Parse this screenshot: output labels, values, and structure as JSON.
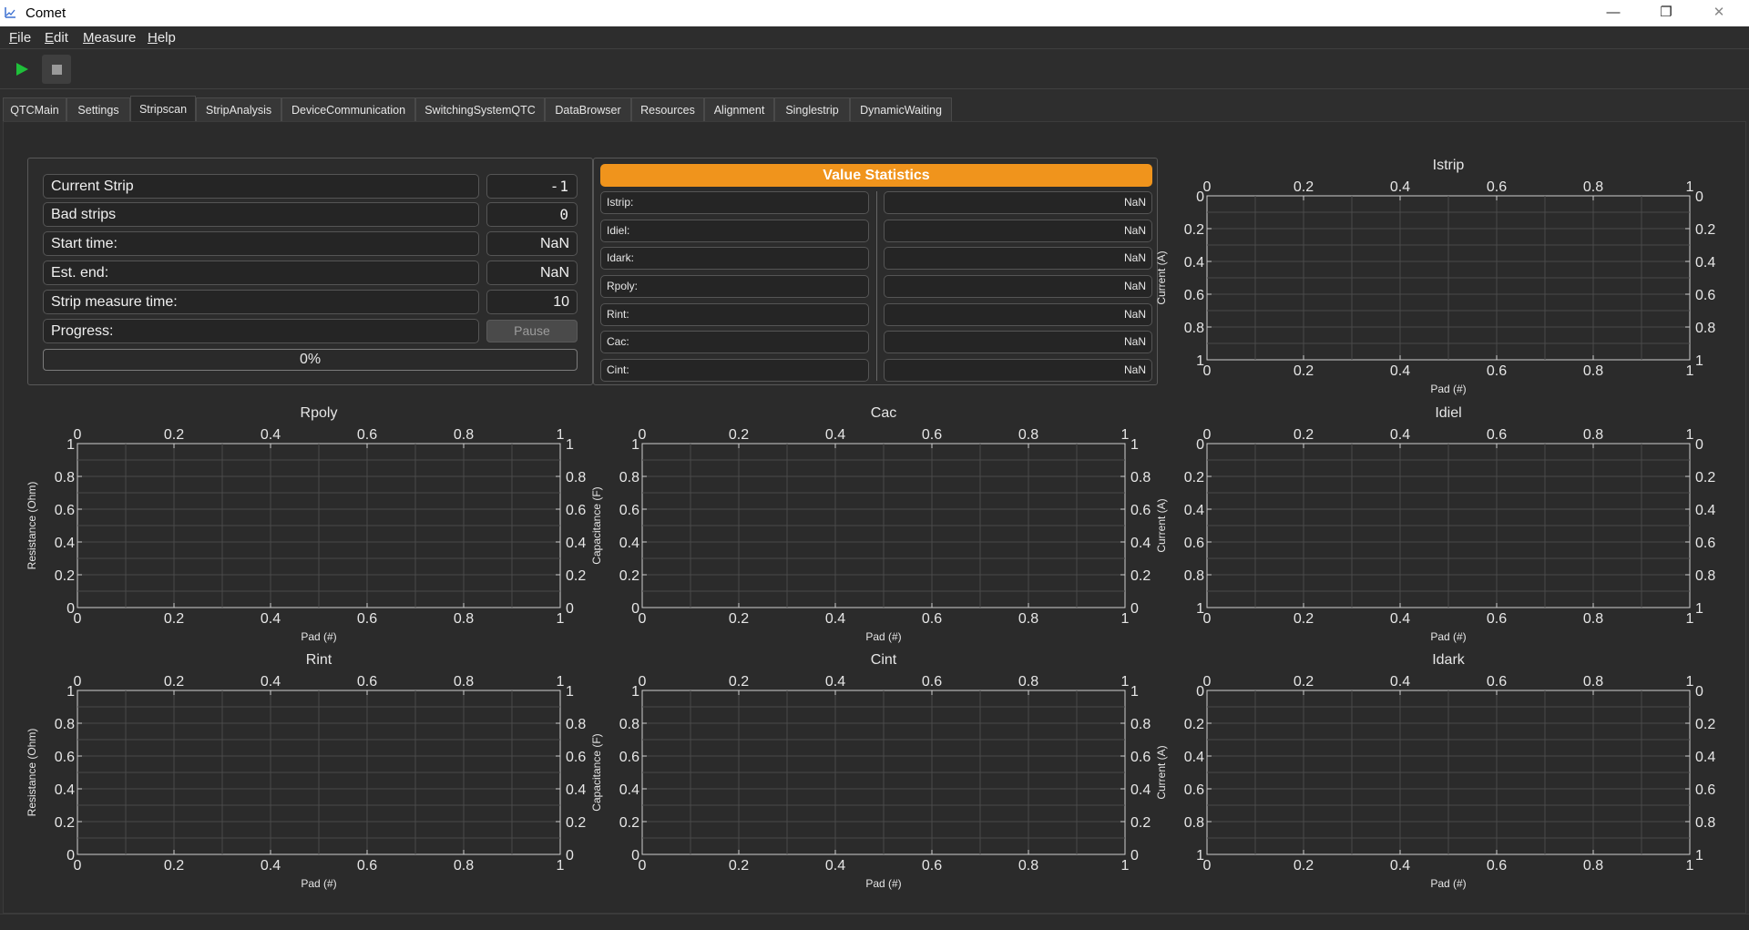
{
  "window": {
    "title": "Comet",
    "minimize": "—",
    "restore": "❐",
    "close": "✕"
  },
  "menu": [
    {
      "label": "File",
      "underline": "F",
      "rest": "ile"
    },
    {
      "label": "Edit",
      "underline": "E",
      "rest": "dit"
    },
    {
      "label": "Measure",
      "underline": "M",
      "rest": "easure"
    },
    {
      "label": "Help",
      "underline": "H",
      "rest": "elp"
    }
  ],
  "toolbar": {
    "start_icon": "play-icon",
    "stop_icon": "stop-icon",
    "start_color": "#1fbf3a",
    "stop_color": "#8a8a8a"
  },
  "tabs": [
    {
      "label": "QTCMain"
    },
    {
      "label": "Settings"
    },
    {
      "label": "Stripscan",
      "active": true
    },
    {
      "label": "StripAnalysis"
    },
    {
      "label": "DeviceCommunication"
    },
    {
      "label": "SwitchingSystemQTC"
    },
    {
      "label": "DataBrowser"
    },
    {
      "label": "Resources"
    },
    {
      "label": "Alignment"
    },
    {
      "label": "Singlestrip"
    },
    {
      "label": "DynamicWaiting"
    }
  ],
  "info": {
    "current_strip_label": "Current Strip",
    "current_strip_value": "-1",
    "bad_strips_label": "Bad strips",
    "bad_strips_value": "0",
    "start_time_label": "Start time:",
    "start_time_value": "NaN",
    "est_end_label": "Est. end:",
    "est_end_value": "NaN",
    "strip_measure_time_label": "Strip measure time:",
    "strip_measure_time_value": "10",
    "progress_label": "Progress:",
    "pause_label": "Pause",
    "progress_text": "0%",
    "progress_fraction": 0
  },
  "stats": {
    "title": "Value Statistics",
    "accent": "#f0941c",
    "rows": [
      {
        "label": "Istrip:",
        "value": "NaN"
      },
      {
        "label": "Idiel:",
        "value": "NaN"
      },
      {
        "label": "Idark:",
        "value": "NaN"
      },
      {
        "label": "Rpoly:",
        "value": "NaN"
      },
      {
        "label": "Rint:",
        "value": "NaN"
      },
      {
        "label": "Cac:",
        "value": "NaN"
      },
      {
        "label": "Cint:",
        "value": "NaN"
      }
    ]
  },
  "plots": [
    {
      "title": "Istrip",
      "xlabel": "Pad (#)",
      "ylabel": "Current (A)",
      "inverted": true
    },
    {
      "title": "Rpoly",
      "xlabel": "Pad (#)",
      "ylabel": "Resistance (Ohm)",
      "inverted": false
    },
    {
      "title": "Cac",
      "xlabel": "Pad (#)",
      "ylabel": "Capacitance (F)",
      "inverted": false
    },
    {
      "title": "Idiel",
      "xlabel": "Pad (#)",
      "ylabel": "Current (A)",
      "inverted": true
    },
    {
      "title": "Rint",
      "xlabel": "Pad (#)",
      "ylabel": "Resistance (Ohm)",
      "inverted": false
    },
    {
      "title": "Cint",
      "xlabel": "Pad (#)",
      "ylabel": "Capacitance (F)",
      "inverted": false
    },
    {
      "title": "Idark",
      "xlabel": "Pad (#)",
      "ylabel": "Current (A)",
      "inverted": true
    }
  ],
  "plot_ticks": [
    "0",
    "0.2",
    "0.4",
    "0.6",
    "0.8",
    "1"
  ]
}
